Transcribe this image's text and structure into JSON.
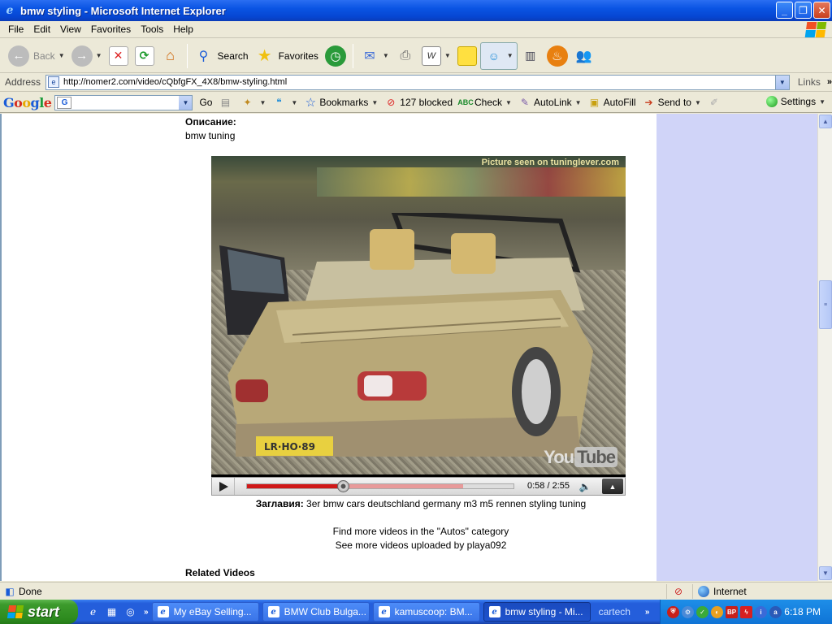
{
  "window": {
    "title": "bmw styling - Microsoft Internet Explorer",
    "minimize": "_",
    "maximize": "❐",
    "close": "✕"
  },
  "menu": {
    "items": [
      "File",
      "Edit",
      "View",
      "Favorites",
      "Tools",
      "Help"
    ]
  },
  "toolbar": {
    "back_label": "Back",
    "search_label": "Search",
    "favorites_label": "Favorites"
  },
  "address": {
    "label": "Address",
    "url": "http://nomer2.com/video/cQbfgFX_4X8/bmw-styling.html",
    "links_label": "Links"
  },
  "google_toolbar": {
    "go_label": "Go",
    "bookmarks_label": "Bookmarks",
    "blocked_label": "127 blocked",
    "check_label": "Check",
    "autolink_label": "AutoLink",
    "autofill_label": "AutoFill",
    "sendto_label": "Send to",
    "settings_label": "Settings"
  },
  "page": {
    "description_label": "Описание:",
    "description_value": "bmw tuning",
    "video_watermark": "Picture seen on tuninglever.com",
    "youtube_logo_you": "You",
    "youtube_logo_tube": "Tube",
    "title_label": "Заглавия:",
    "title_value": "3er bmw cars deutschland germany m3 m5 rennen styling tuning",
    "more_category": "Find more videos in the \"Autos\" category",
    "more_user": "See more videos uploaded by playa092",
    "related_heading": "Related Videos"
  },
  "player": {
    "time": "0:58 / 2:55",
    "played_fraction": 0.36,
    "loaded_fraction": 0.81
  },
  "statusbar": {
    "status": "Done",
    "zone": "Internet"
  },
  "taskbar": {
    "start_label": "start",
    "tasks": [
      "My eBay Selling...",
      "BMW Club Bulga...",
      "kamuscoop: BM...",
      "bmw styling - Mi..."
    ],
    "toolbar_label": "cartech",
    "clock": "6:18 PM"
  },
  "colors": {
    "title_bar": "#0a54e3",
    "progress_played": "#d01818",
    "page_side_strip": "#d0d4f8",
    "taskbar": "#245edb",
    "start_button": "#3c9a2c"
  }
}
